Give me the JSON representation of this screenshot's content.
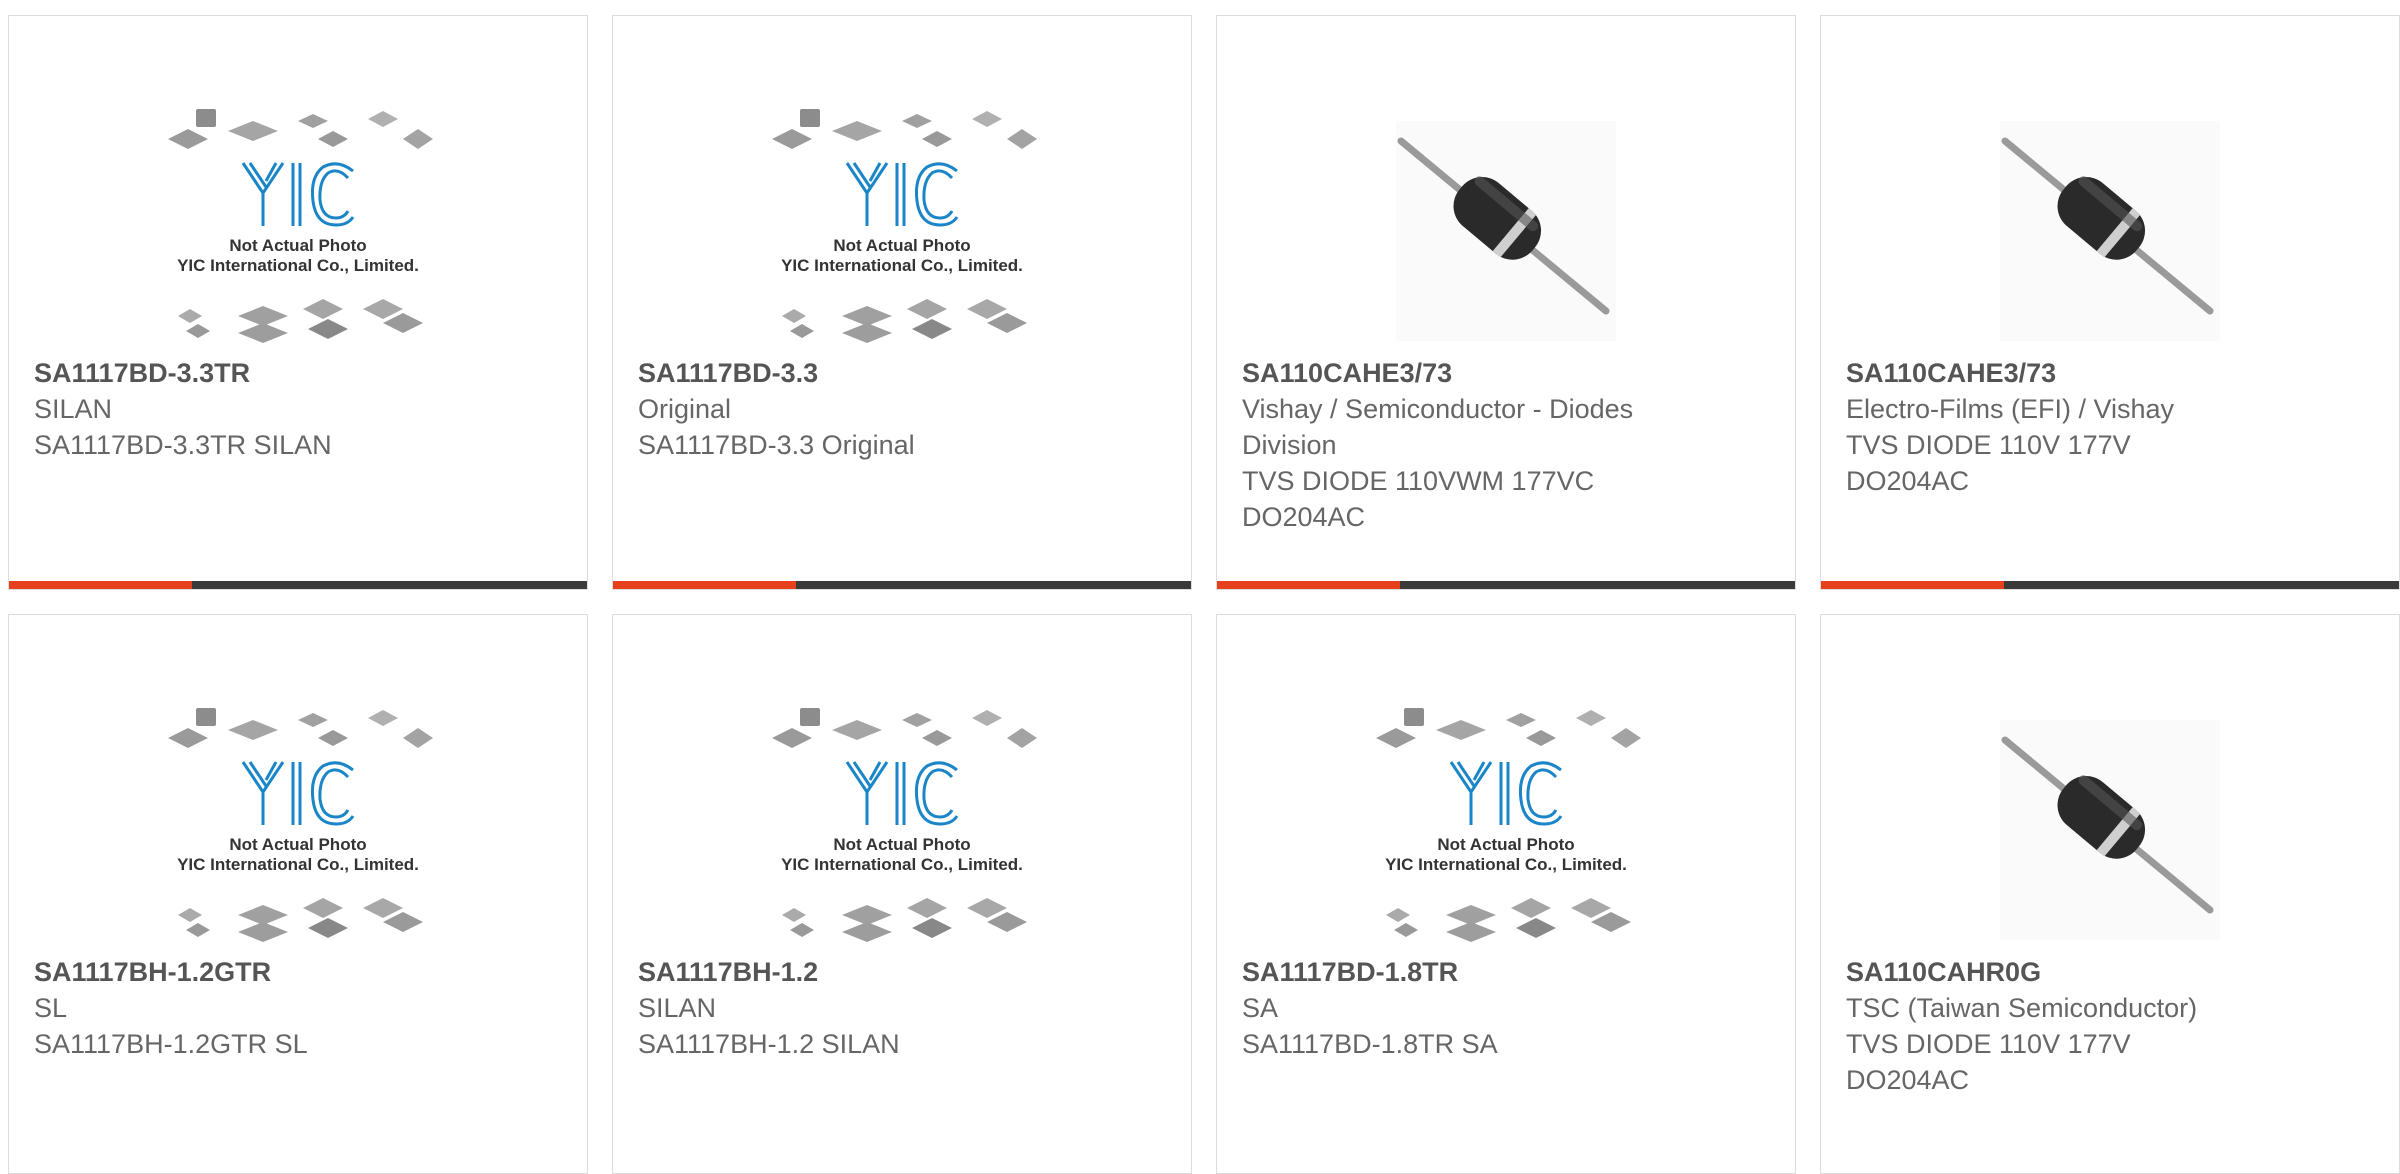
{
  "products": [
    {
      "part": "SA1117BD-3.3TR",
      "lines": [
        "SILAN",
        "SA1117BD-3.3TR SILAN"
      ],
      "image": "yic-placeholder"
    },
    {
      "part": "SA1117BD-3.3",
      "lines": [
        "Original",
        "SA1117BD-3.3 Original"
      ],
      "image": "yic-placeholder"
    },
    {
      "part": "SA110CAHE3/73",
      "lines": [
        "Vishay / Semiconductor - Diodes",
        "Division",
        "TVS DIODE 110VWM 177VC",
        "DO204AC"
      ],
      "image": "diode"
    },
    {
      "part": "SA110CAHE3/73",
      "lines": [
        "Electro-Films (EFI) / Vishay",
        "TVS DIODE 110V 177V",
        "DO204AC"
      ],
      "image": "diode"
    },
    {
      "part": "SA1117BH-1.2GTR",
      "lines": [
        "SL",
        "SA1117BH-1.2GTR SL"
      ],
      "image": "yic-placeholder"
    },
    {
      "part": "SA1117BH-1.2",
      "lines": [
        "SILAN",
        "SA1117BH-1.2 SILAN"
      ],
      "image": "yic-placeholder"
    },
    {
      "part": "SA1117BD-1.8TR",
      "lines": [
        "SA",
        "SA1117BD-1.8TR SA"
      ],
      "image": "yic-placeholder"
    },
    {
      "part": "SA110CAHR0G",
      "lines": [
        "TSC (Taiwan Semiconductor)",
        "TVS DIODE 110V 177V",
        "DO204AC"
      ],
      "image": "diode"
    }
  ],
  "placeholder": {
    "logo_text": "YIC",
    "line1": "Not Actual Photo",
    "line2": "YIC International Co., Limited."
  },
  "colors": {
    "accent": "#e8401c",
    "bar": "#3a3a3a",
    "logo_blue": "#1a86c8"
  }
}
